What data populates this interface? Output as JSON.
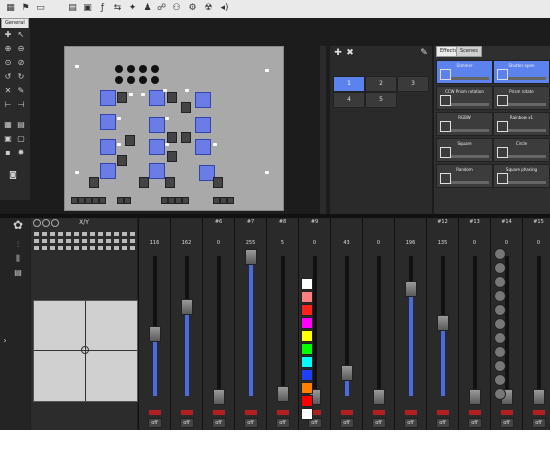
{
  "toolbar": {
    "icons": [
      "grid-icon",
      "flag-icon",
      "monitor-icon",
      "sliders-icon",
      "sequence-icon",
      "function-icon",
      "chaser-icon",
      "bulb-icon",
      "people-icon",
      "gear-icon",
      "control-icon",
      "audio-icon",
      "speaker-icon"
    ]
  },
  "tabs": {
    "general": "General"
  },
  "groups": {
    "buttons": [
      "1",
      "2",
      "3",
      "4",
      "5"
    ],
    "selected": "1"
  },
  "effects": {
    "tabs": [
      "Effects",
      "Scenes"
    ],
    "items": [
      {
        "label": "Dimmer",
        "on": true
      },
      {
        "label": "Shutter open",
        "on": true
      },
      {
        "label": "CCW Prism rotation",
        "on": false
      },
      {
        "label": "Prism rotate",
        "on": false
      },
      {
        "label": "RGBW",
        "on": false
      },
      {
        "label": "Rainbow x1",
        "on": false
      },
      {
        "label": "Square",
        "on": false
      },
      {
        "label": "Circle",
        "on": false
      },
      {
        "label": "Random",
        "on": false
      },
      {
        "label": "Square phasing",
        "on": false
      }
    ]
  },
  "xy": {
    "title": "X/Y"
  },
  "channels": [
    {
      "num": "",
      "value": "116",
      "level": 0.45
    },
    {
      "num": "",
      "value": "162",
      "level": 0.64
    },
    {
      "num": "#6",
      "value": "0",
      "level": 0.0
    },
    {
      "num": "#7",
      "value": "255",
      "level": 1.0
    },
    {
      "num": "#8",
      "value": "5",
      "level": 0.02
    },
    {
      "num": "#9",
      "value": "0",
      "level": 0.0
    },
    {
      "num": "",
      "value": "43",
      "level": 0.17
    },
    {
      "num": "",
      "value": "0",
      "level": 0.0
    },
    {
      "num": "",
      "value": "196",
      "level": 0.77
    },
    {
      "num": "#12",
      "value": "135",
      "level": 0.53
    },
    {
      "num": "#13",
      "value": "0",
      "level": 0.0
    },
    {
      "num": "#14",
      "value": "0",
      "level": 0.0
    },
    {
      "num": "#15",
      "value": "0",
      "level": 0.0
    }
  ],
  "off_label": "off",
  "colors": {
    "accent": "#5c82ee",
    "selection": "#6a7de6",
    "panel": "#2a2a2a",
    "red": "#b02020"
  },
  "color_swatches": [
    "#ffffff",
    "#ff8080",
    "#ff2020",
    "#ff00ff",
    "#ffff00",
    "#00ff00",
    "#00ffff",
    "#2040ff",
    "#ff8000",
    "#ff0000",
    "#ffffff"
  ]
}
